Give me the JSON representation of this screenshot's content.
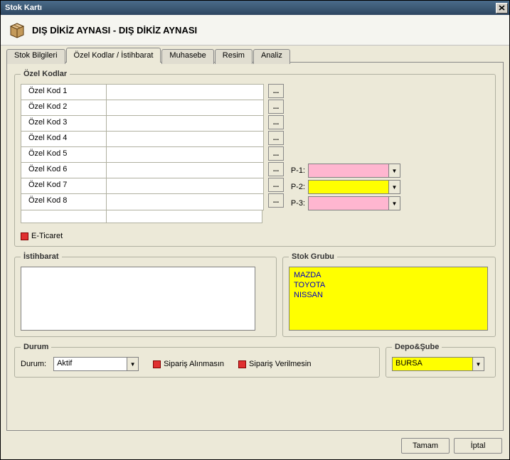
{
  "window": {
    "title": "Stok Kartı"
  },
  "header": {
    "title": "DIŞ DİKİZ AYNASI - DIŞ DİKİZ AYNASI"
  },
  "tabs": {
    "t1": "Stok Bilgileri",
    "t2": "Özel Kodlar / İstihbarat",
    "t3": "Muhasebe",
    "t4": "Resim",
    "t5": "Analiz"
  },
  "ozel_kodlar": {
    "legend": "Özel Kodlar",
    "rows": [
      "Özel Kod 1",
      "Özel Kod 2",
      "Özel Kod 3",
      "Özel Kod 4",
      "Özel Kod 5",
      "Özel Kod 6",
      "Özel Kod 7",
      "Özel Kod 8"
    ],
    "p1": "P-1:",
    "p2": "P-2:",
    "p3": "P-3:",
    "eticaret": "E-Ticaret",
    "p1_color": "#ffb6d0",
    "p2_color": "#ffff00",
    "p3_color": "#ffb6d0"
  },
  "istihbarat": {
    "legend": "İstihbarat",
    "text": ""
  },
  "stok_grubu": {
    "legend": "Stok Grubu",
    "items": [
      "MAZDA",
      "TOYOTA",
      "NISSAN"
    ]
  },
  "durum": {
    "legend": "Durum",
    "label": "Durum:",
    "value": "Aktif",
    "siparis_alinmasin": "Sipariş Alınmasın",
    "siparis_verilmesin": "Sipariş Verilmesin"
  },
  "depo": {
    "legend": "Depo&Şube",
    "value": "BURSA"
  },
  "buttons": {
    "ok": "Tamam",
    "cancel": "İptal",
    "ellipsis": "..."
  }
}
